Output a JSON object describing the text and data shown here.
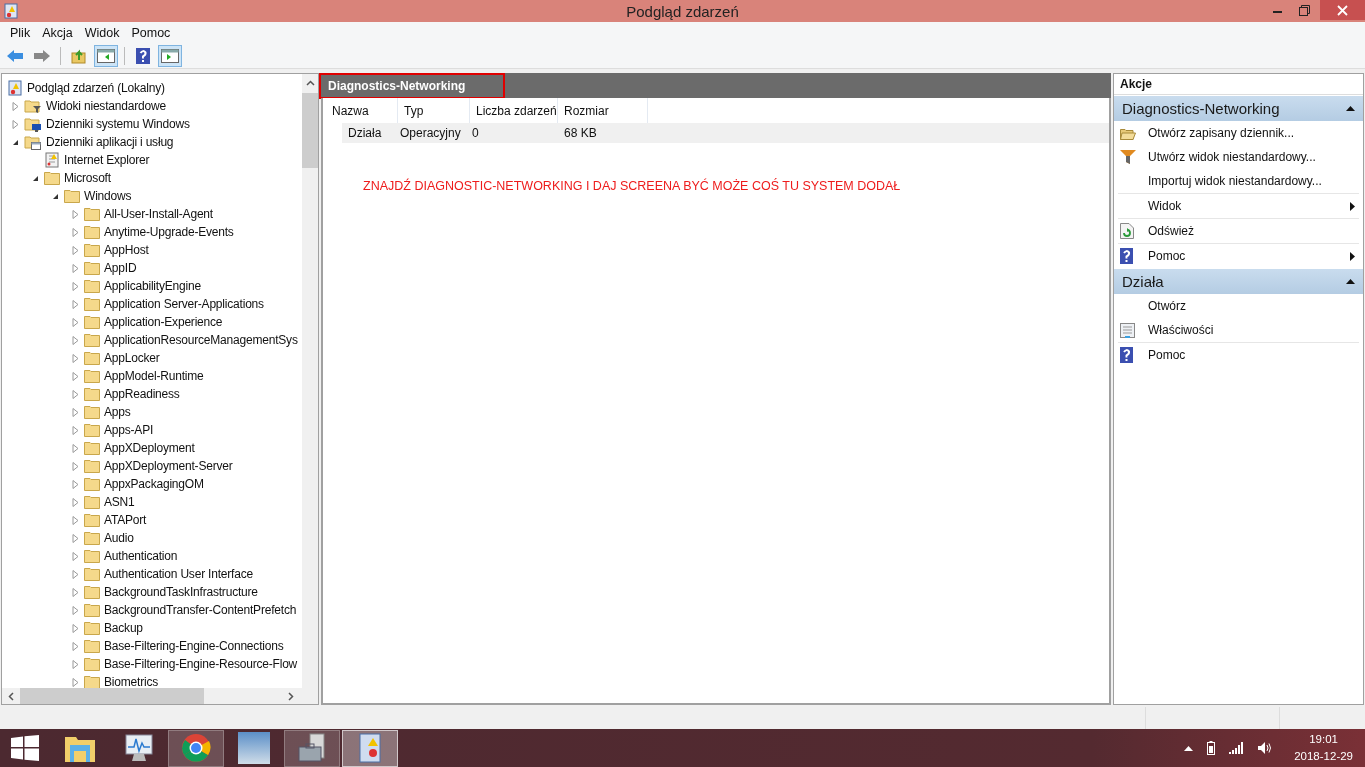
{
  "window": {
    "title": "Podgląd zdarzeń"
  },
  "menu": [
    {
      "label": "Plik"
    },
    {
      "label": "Akcja"
    },
    {
      "label": "Widok"
    },
    {
      "label": "Pomoc"
    }
  ],
  "toolbar": [
    {
      "kind": "back",
      "pressed": false
    },
    {
      "kind": "forward",
      "pressed": false
    },
    {
      "kind": "up",
      "pressed": false
    },
    {
      "kind": "tree-toggle",
      "pressed": true
    },
    {
      "kind": "help",
      "pressed": false
    },
    {
      "kind": "actions-toggle",
      "pressed": true
    }
  ],
  "tree": {
    "items": [
      {
        "label": "Podgląd zdarzeń (Lokalny)",
        "kind": "viewer",
        "children": [
          {
            "label": "Widoki niestandardowe",
            "kind": "filter-folder",
            "expanded": false
          },
          {
            "label": "Dzienniki systemu Windows",
            "kind": "system-folder",
            "expanded": false
          },
          {
            "label": "Dzienniki aplikacji i usług",
            "kind": "log-folder",
            "expanded": true,
            "children": [
              {
                "label": "Internet Explorer",
                "kind": "log"
              },
              {
                "label": "Microsoft",
                "kind": "folder",
                "expanded": true,
                "children": [
                  {
                    "label": "Windows",
                    "kind": "folder",
                    "expanded": true,
                    "children": [
                      {
                        "label": "All-User-Install-Agent",
                        "kind": "folder",
                        "expanded": false
                      },
                      {
                        "label": "Anytime-Upgrade-Events",
                        "kind": "folder",
                        "expanded": false
                      },
                      {
                        "label": "AppHost",
                        "kind": "folder",
                        "expanded": false
                      },
                      {
                        "label": "AppID",
                        "kind": "folder",
                        "expanded": false
                      },
                      {
                        "label": "ApplicabilityEngine",
                        "kind": "folder",
                        "expanded": false
                      },
                      {
                        "label": "Application Server-Applications",
                        "kind": "folder",
                        "expanded": false
                      },
                      {
                        "label": "Application-Experience",
                        "kind": "folder",
                        "expanded": false
                      },
                      {
                        "label": "ApplicationResourceManagementSys",
                        "kind": "folder",
                        "expanded": false
                      },
                      {
                        "label": "AppLocker",
                        "kind": "folder",
                        "expanded": false
                      },
                      {
                        "label": "AppModel-Runtime",
                        "kind": "folder",
                        "expanded": false
                      },
                      {
                        "label": "AppReadiness",
                        "kind": "folder",
                        "expanded": false
                      },
                      {
                        "label": "Apps",
                        "kind": "folder",
                        "expanded": false
                      },
                      {
                        "label": "Apps-API",
                        "kind": "folder",
                        "expanded": false
                      },
                      {
                        "label": "AppXDeployment",
                        "kind": "folder",
                        "expanded": false
                      },
                      {
                        "label": "AppXDeployment-Server",
                        "kind": "folder",
                        "expanded": false
                      },
                      {
                        "label": "AppxPackagingOM",
                        "kind": "folder",
                        "expanded": false
                      },
                      {
                        "label": "ASN1",
                        "kind": "folder",
                        "expanded": false
                      },
                      {
                        "label": "ATAPort",
                        "kind": "folder",
                        "expanded": false
                      },
                      {
                        "label": "Audio",
                        "kind": "folder",
                        "expanded": false
                      },
                      {
                        "label": "Authentication",
                        "kind": "folder",
                        "expanded": false
                      },
                      {
                        "label": "Authentication User Interface",
                        "kind": "folder",
                        "expanded": false
                      },
                      {
                        "label": "BackgroundTaskInfrastructure",
                        "kind": "folder",
                        "expanded": false
                      },
                      {
                        "label": "BackgroundTransfer-ContentPrefetch",
                        "kind": "folder",
                        "expanded": false
                      },
                      {
                        "label": "Backup",
                        "kind": "folder",
                        "expanded": false
                      },
                      {
                        "label": "Base-Filtering-Engine-Connections",
                        "kind": "folder",
                        "expanded": false
                      },
                      {
                        "label": "Base-Filtering-Engine-Resource-Flow",
                        "kind": "folder",
                        "expanded": false
                      },
                      {
                        "label": "Biometrics",
                        "kind": "folder",
                        "expanded": false
                      }
                    ]
                  }
                ]
              }
            ]
          }
        ]
      }
    ]
  },
  "center": {
    "title": "Diagnostics-Networking",
    "outlined": true,
    "columns": [
      "Nazwa",
      "Typ",
      "Liczba zdarzeń",
      "Rozmiar"
    ],
    "rows": [
      {
        "cells": [
          "Działa",
          "Operacyjny",
          "0",
          "68 KB"
        ],
        "selected": true
      }
    ],
    "note": "ZNAJDŹ DIAGNOSTIC-NETWORKING I DAJ SCREENA BYĆ MOŻE COŚ TU SYSTEM DODAŁ"
  },
  "actions": {
    "title": "Akcje",
    "sections": [
      {
        "title": "Diagnostics-Networking",
        "expanded": true,
        "items": [
          {
            "label": "Otwórz zapisany dziennik...",
            "kind": "open-folder",
            "submenu": false,
            "divider": false
          },
          {
            "label": "Utwórz widok niestandardowy...",
            "kind": "filter",
            "submenu": false,
            "divider": false
          },
          {
            "label": "Importuj widok niestandardowy...",
            "kind": "none",
            "submenu": false,
            "divider": true
          },
          {
            "label": "Widok",
            "kind": "none",
            "submenu": true,
            "divider": true
          },
          {
            "label": "Odśwież",
            "kind": "refresh",
            "submenu": false,
            "divider": true
          },
          {
            "label": "Pomoc",
            "kind": "help",
            "submenu": true,
            "divider": false
          }
        ]
      },
      {
        "title": "Działa",
        "expanded": true,
        "items": [
          {
            "label": "Otwórz",
            "kind": "none",
            "submenu": false,
            "divider": false
          },
          {
            "label": "Właściwości",
            "kind": "properties",
            "submenu": false,
            "divider": true
          },
          {
            "label": "Pomoc",
            "kind": "help",
            "submenu": false,
            "divider": false
          }
        ]
      }
    ]
  },
  "taskbar": {
    "apps": [
      {
        "kind": "explorer",
        "running": false,
        "selected": false
      },
      {
        "kind": "monitor",
        "running": false,
        "selected": false
      },
      {
        "kind": "chrome",
        "running": true,
        "selected": false
      },
      {
        "kind": "game",
        "running": false,
        "selected": false
      },
      {
        "kind": "toolbox",
        "running": true,
        "selected": false
      },
      {
        "kind": "viewer",
        "running": true,
        "selected": true
      }
    ],
    "time": "19:01",
    "date": "2018-12-29"
  }
}
